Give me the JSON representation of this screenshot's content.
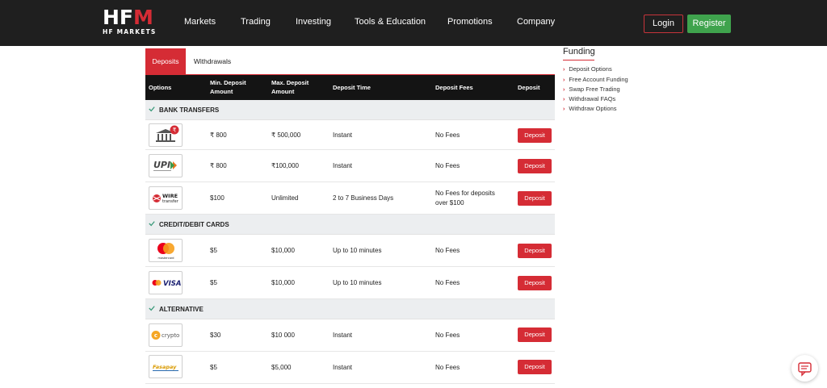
{
  "header": {
    "logo_text": "HFM",
    "logo_sub": "HF MARKETS",
    "nav": [
      {
        "label": "Markets"
      },
      {
        "label": "Trading"
      },
      {
        "label": "Investing"
      },
      {
        "label": "Tools & Education"
      },
      {
        "label": "Promotions"
      },
      {
        "label": "Company"
      }
    ],
    "login_label": "Login",
    "register_label": "Register"
  },
  "tabs": {
    "deposits": "Deposits",
    "withdrawals": "Withdrawals"
  },
  "table": {
    "columns": [
      "Options",
      "Min. Deposit Amount",
      "Max. Deposit Amount",
      "Deposit Time",
      "Deposit Fees",
      "Deposit"
    ],
    "categories": {
      "bank": "BANK TRANSFERS",
      "cards": "CREDIT/DEBIT CARDS",
      "alt": "ALTERNATIVE"
    },
    "rows": [
      {
        "option": "local bank transfer",
        "min": "₹ 800",
        "max": "₹ 500,000",
        "time": "Instant",
        "fees": "No Fees",
        "button": "Deposit"
      },
      {
        "option": "UPI",
        "min": "₹ 800",
        "max": "₹100,000",
        "time": "Instant",
        "fees": "No Fees",
        "button": "Deposit"
      },
      {
        "option": "WIRE transfer",
        "min": "$100",
        "max": "Unlimited",
        "time": "2 to 7 Business Days",
        "fees": "No Fees for deposits over $100",
        "button": "Deposit"
      },
      {
        "option": "mastercard",
        "min": "$5",
        "max": "$10,000",
        "time": "Up to 10 minutes",
        "fees": "No Fees",
        "button": "Deposit"
      },
      {
        "option": "VISA",
        "min": "$5",
        "max": "$10,000",
        "time": "Up to 10 minutes",
        "fees": "No Fees",
        "button": "Deposit"
      },
      {
        "option": "crypto",
        "min": "$30",
        "max": "$10 000",
        "time": "Instant",
        "fees": "No Fees",
        "button": "Deposit"
      },
      {
        "option": "Fasapay",
        "min": "$5",
        "max": "$5,000",
        "time": "Instant",
        "fees": "No Fees",
        "button": "Deposit"
      }
    ],
    "logo_texts": {
      "upi": "UPI",
      "wire_top": "WIRE",
      "wire_bottom": "transfer",
      "mastercard": "mastercard",
      "visa": "VISA",
      "crypto": "crypto",
      "fasapay": "Fasapay"
    }
  },
  "sidebar": {
    "title": "Funding",
    "links": [
      "Deposit Options",
      "Free Account Funding",
      "Swap Free Trading",
      "Withdrawal FAQs",
      "Withdraw Options"
    ]
  },
  "colors": {
    "brand_red": "#d52c35",
    "register_green": "#3fa34d",
    "header_bg": "#1f1f1f"
  },
  "icons": [
    "check-icon",
    "chevron-right-icon",
    "chat-icon",
    "bank-icon",
    "rupee-icon"
  ]
}
